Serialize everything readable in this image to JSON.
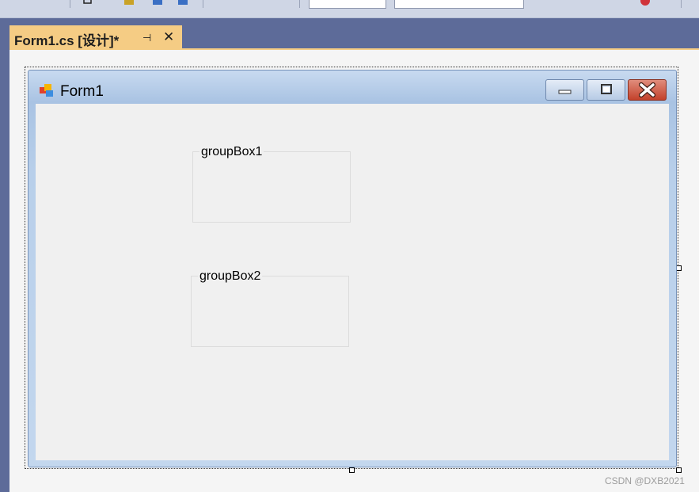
{
  "tab": {
    "title": "Form1.cs [设计]*",
    "pin_glyph": "⊣",
    "close_glyph": "✕"
  },
  "form": {
    "title": "Form1",
    "icon": "windows-form-icon",
    "caption_buttons": [
      "minimize-icon",
      "maximize-icon",
      "close-icon"
    ],
    "group_boxes": [
      {
        "label": "groupBox1"
      },
      {
        "label": "groupBox2"
      }
    ]
  },
  "watermark": "CSDN @DXB2021",
  "colors": {
    "background": "#5d6b99",
    "tab_active": "#f5cc84",
    "client_area": "#f0f0f0",
    "close_button": "#c3412b"
  }
}
